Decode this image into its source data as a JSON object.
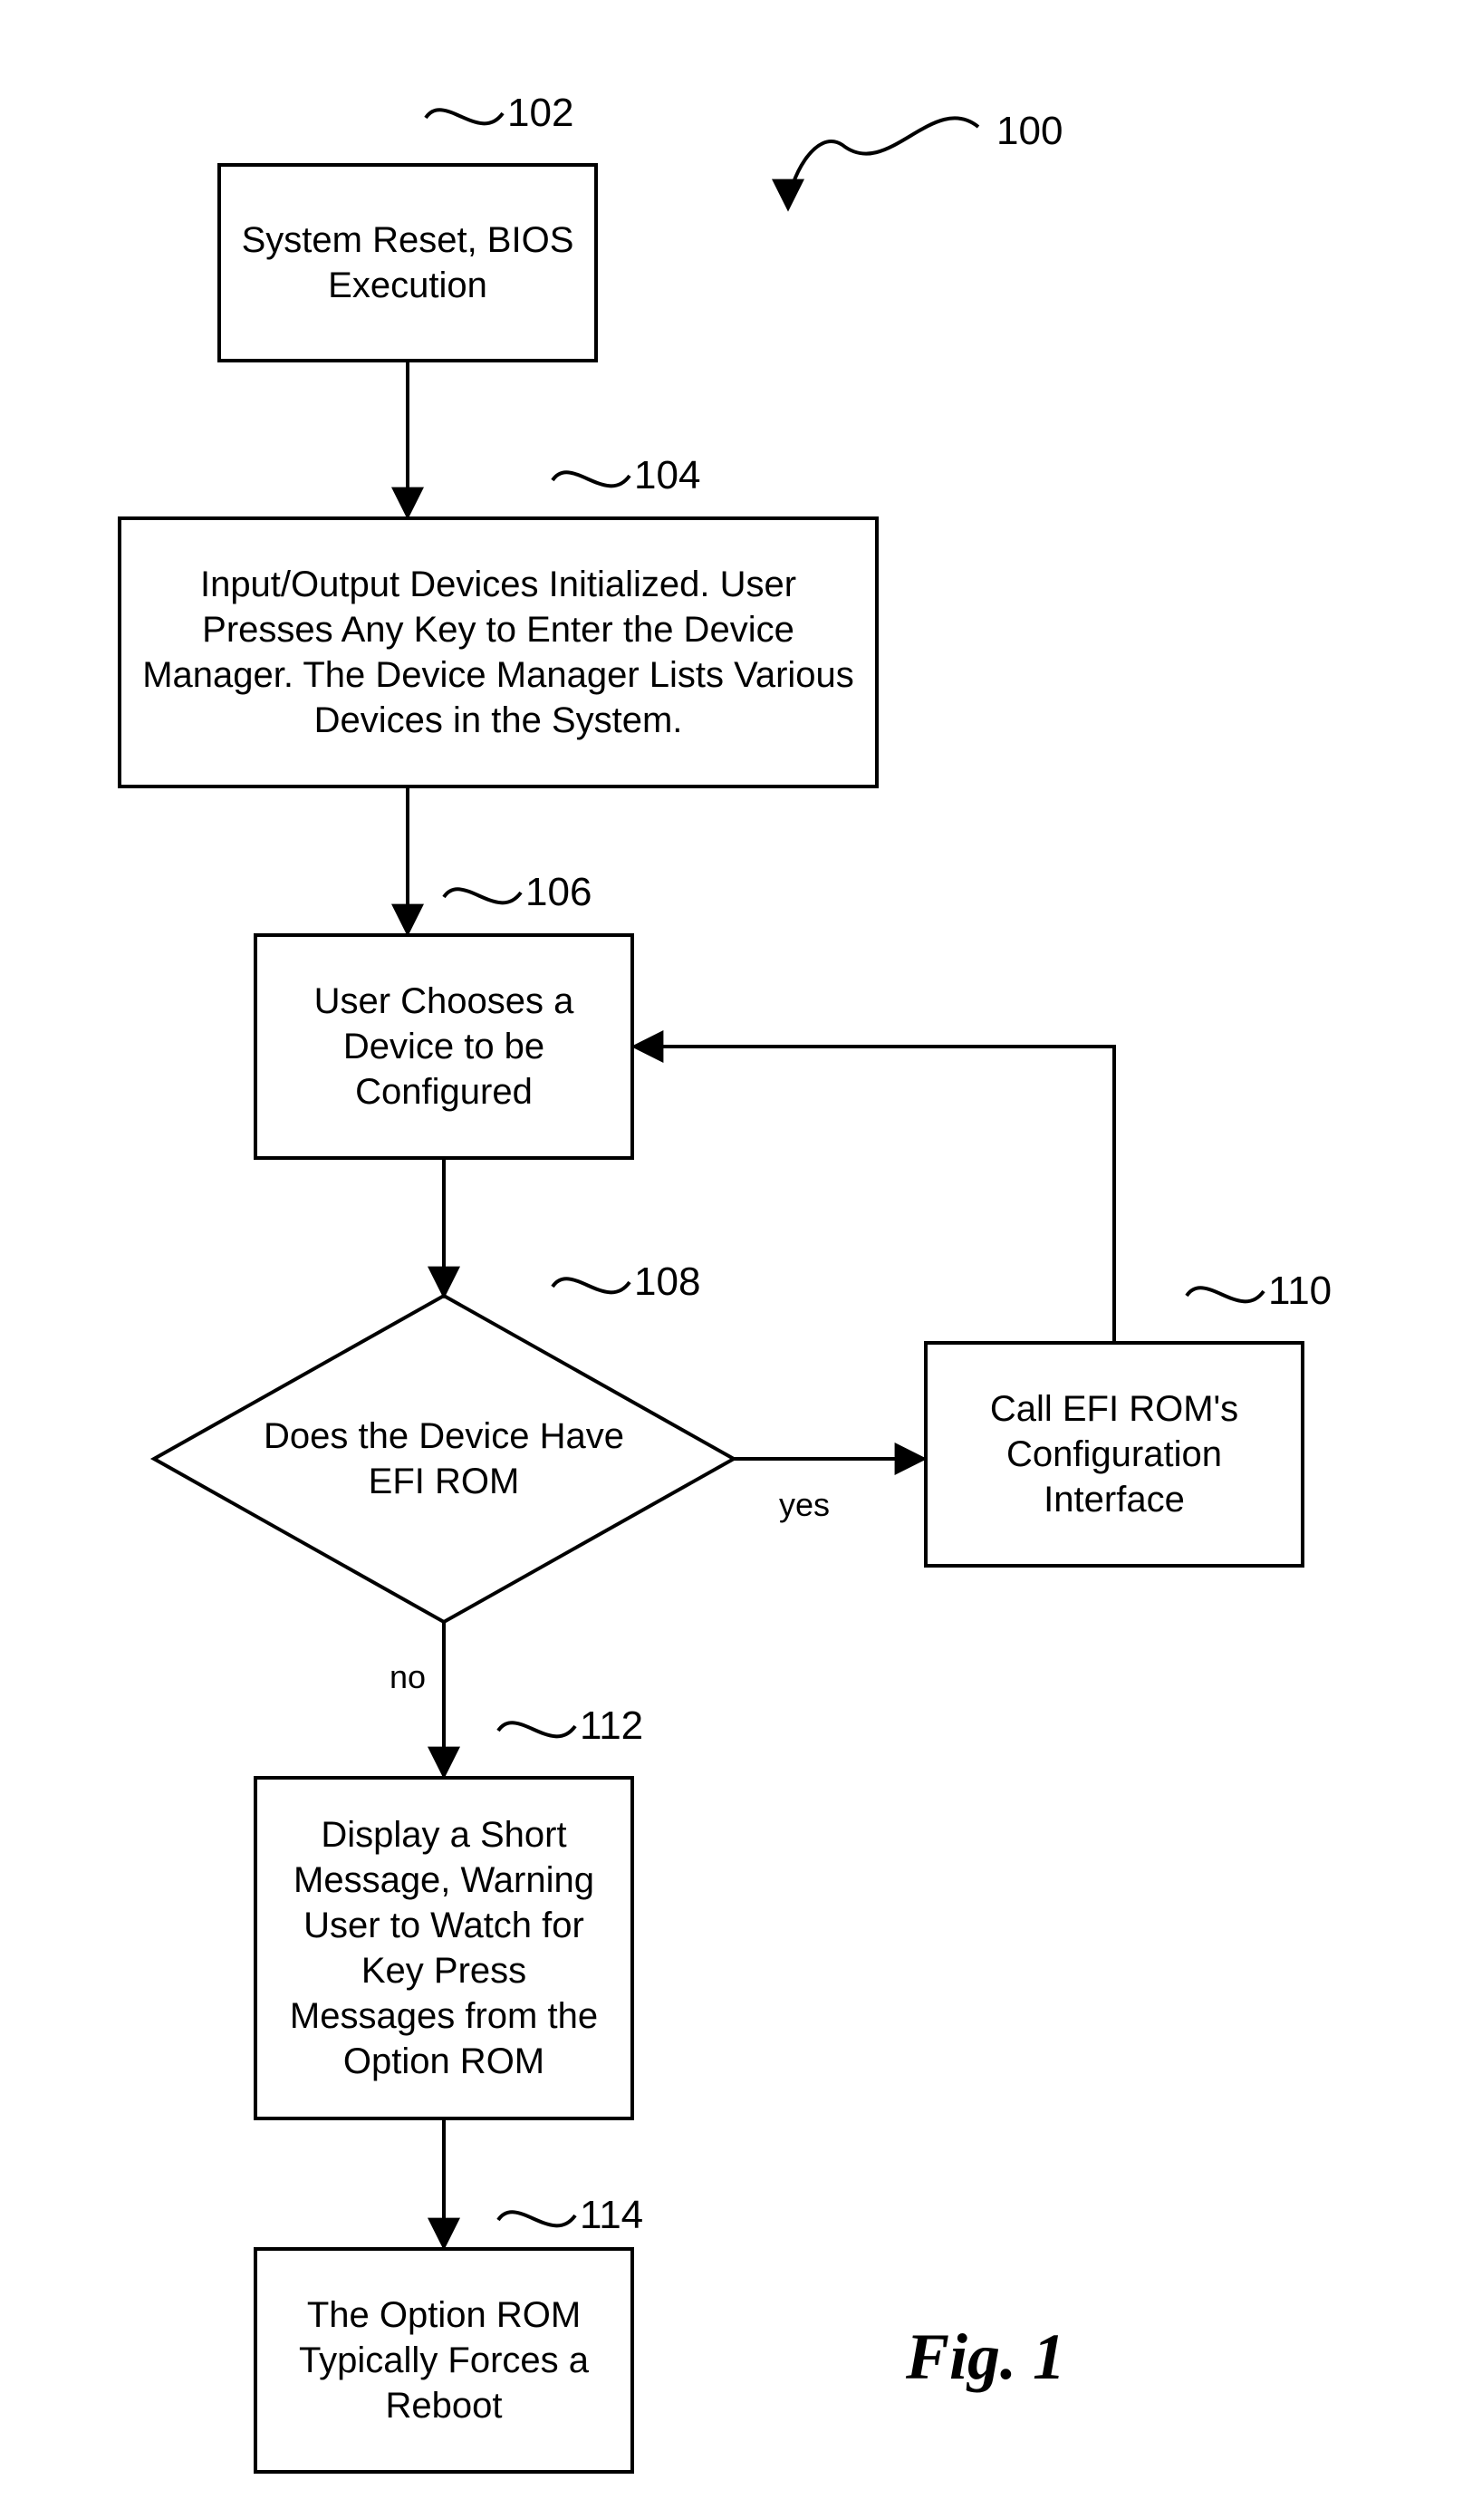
{
  "refs": {
    "r100": "100",
    "r102": "102",
    "r104": "104",
    "r106": "106",
    "r108": "108",
    "r110": "110",
    "r112": "112",
    "r114": "114"
  },
  "nodes": {
    "n102": "System Reset, BIOS Execution",
    "n104": "Input/Output Devices Initialized.  User Presses Any Key to Enter the Device Manager.  The Device Manager Lists Various Devices in the System.",
    "n106": "User Chooses a Device to be Configured",
    "n108": "Does the Device Have EFI ROM",
    "n110": "Call EFI ROM's Configuration Interface",
    "n112": "Display a Short Message, Warning User to Watch for Key Press Messages from the Option ROM",
    "n114": "The Option ROM Typically Forces a Reboot"
  },
  "edge_labels": {
    "yes": "yes",
    "no": "no"
  },
  "figure_caption": "Fig. 1"
}
